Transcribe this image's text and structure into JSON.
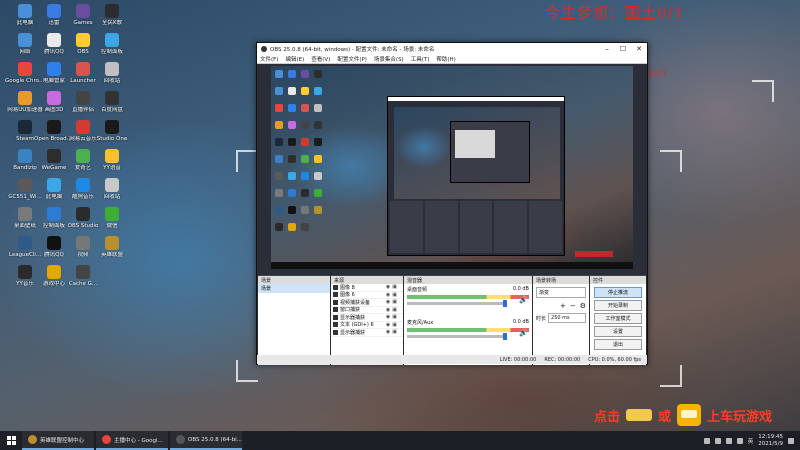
{
  "wallpaper": {
    "headline": "今生梦想：国土0/1",
    "subline": "今生梦想：国土0/1",
    "promo_left": "点击",
    "promo_mid": "或",
    "promo_right": "上车玩游戏",
    "promo_badge": "上车玩游戏"
  },
  "desktop_icons": [
    {
      "id": "computer",
      "label": "此电脑",
      "color": "#4a90d9"
    },
    {
      "id": "thunder",
      "label": "迅雷",
      "color": "#3b7be0"
    },
    {
      "id": "games",
      "label": "Games",
      "color": "#6a4ca0"
    },
    {
      "id": "media",
      "label": "全民K歌",
      "color": "#2d2d2d"
    },
    {
      "id": "network",
      "label": "网络",
      "color": "#4a90d9"
    },
    {
      "id": "wechat-pc",
      "label": "腾讯QQ",
      "color": "#e9e9e9"
    },
    {
      "id": "obs-shortcut",
      "label": "OBS",
      "color": "#ffcc33"
    },
    {
      "id": "control",
      "label": "控制面板",
      "color": "#3ba7e6"
    },
    {
      "id": "google-chrome",
      "label": "Google Chrome",
      "color": "#e8453c"
    },
    {
      "id": "pc-manager",
      "label": "电脑管家",
      "color": "#2f80ed"
    },
    {
      "id": "launcher",
      "label": "Launcher",
      "color": "#d9534f"
    },
    {
      "id": "recycle",
      "label": "回收站",
      "color": "#bfbfbf"
    },
    {
      "id": "uu",
      "label": "网易UU加速器",
      "color": "#e89b2a"
    },
    {
      "id": "color-app",
      "label": "画图3D",
      "color": "#c86be0"
    },
    {
      "id": "mic",
      "label": "直播伴侣",
      "color": "#444444"
    },
    {
      "id": "baidu",
      "label": "百度网盘",
      "color": "#333333"
    },
    {
      "id": "steam",
      "label": "Steam",
      "color": "#1b2838"
    },
    {
      "id": "open-broadcaster",
      "label": "Open Broadcast...",
      "color": "#1a1a1a"
    },
    {
      "id": "netease",
      "label": "网易云音乐",
      "color": "#d33a31"
    },
    {
      "id": "studio-one",
      "label": "Studio One",
      "color": "#1a1a1a"
    },
    {
      "id": "bandizip",
      "label": "Bandizip",
      "color": "#3b82c4"
    },
    {
      "id": "wegame",
      "label": "WeGame",
      "color": "#2d2d2d"
    },
    {
      "id": "iqiyi",
      "label": "爱奇艺",
      "color": "#4caf50"
    },
    {
      "id": "yy",
      "label": "YY语音",
      "color": "#fbc02d"
    },
    {
      "id": "gc551",
      "label": "GC551_Wi...",
      "color": "#5a5a5a"
    },
    {
      "id": "computer2",
      "label": "此电脑",
      "color": "#3ba7e6"
    },
    {
      "id": "kugou",
      "label": "酷狗音乐",
      "color": "#1e88e5"
    },
    {
      "id": "recycle2",
      "label": "回收站",
      "color": "#c9c9c9"
    },
    {
      "id": "wallpaper",
      "label": "桌面壁纸",
      "color": "#7a7a7a"
    },
    {
      "id": "controlpanel",
      "label": "控制面板",
      "color": "#2e7bd6"
    },
    {
      "id": "obs-studio",
      "label": "OBS Studio",
      "color": "#2b2b2b"
    },
    {
      "id": "wechat",
      "label": "微信",
      "color": "#3cb034"
    },
    {
      "id": "league",
      "label": "LeagueCli...",
      "color": "#2d5a86"
    },
    {
      "id": "qq",
      "label": "腾讯QQ",
      "color": "#111111"
    },
    {
      "id": "video",
      "label": "视频",
      "color": "#777777"
    },
    {
      "id": "league-game",
      "label": "英雄联盟",
      "color": "#b8902f"
    },
    {
      "id": "yy-music",
      "label": "YY音乐",
      "color": "#2a2a2a"
    },
    {
      "id": "game-center",
      "label": "游戏中心",
      "color": "#e0a800"
    },
    {
      "id": "cache",
      "label": "Cache G...",
      "color": "#444444"
    }
  ],
  "obs": {
    "title": "OBS 25.0.8 (64-bit, windows) - 配置文件: 未命名 - 场景: 未命名",
    "menu": [
      "文件(F)",
      "编辑(E)",
      "查看(V)",
      "配置文件(P)",
      "场景集合(S)",
      "工具(T)",
      "帮助(H)"
    ],
    "docks": {
      "scenes": {
        "header": "场景",
        "items": [
          "场景"
        ]
      },
      "sources": {
        "header": "来源",
        "items": [
          "图像 8",
          "图像 6",
          "视频捕获设备",
          "窗口捕获",
          "显示器捕获",
          "文本 (GDI+) 6",
          "显示器捕获"
        ]
      },
      "mixer": {
        "header": "混音器",
        "channels": [
          {
            "name": "桌面音频",
            "db": "0.0 dB"
          },
          {
            "name": "麦克风/Aux",
            "db": "0.0 dB"
          }
        ]
      },
      "transitions": {
        "header": "场景转场",
        "type": "渐变",
        "duration_label": "时长",
        "duration": "250 ms"
      },
      "controls": {
        "header": "控件",
        "buttons": [
          "停止推流",
          "开始录制",
          "工作室模式",
          "设置",
          "退出"
        ],
        "active_index": 0
      }
    },
    "status": {
      "live": "LIVE: 00:00:00",
      "rec": "REC: 00:00:00",
      "cpu": "CPU: 0.0%, 60.00 fps"
    }
  },
  "taskbar": {
    "items": [
      {
        "id": "task-control-center",
        "label": "英雄联盟控制中心",
        "color": "#b8902f"
      },
      {
        "id": "task-chrome",
        "label": "主播中心 - Googl...",
        "color": "#e8453c"
      },
      {
        "id": "task-obs",
        "label": "OBS 25.0.8 (64-bi...",
        "color": "#555555"
      }
    ],
    "tray_lang": "英",
    "time": "12:19:45",
    "date": "2021/5/9"
  }
}
